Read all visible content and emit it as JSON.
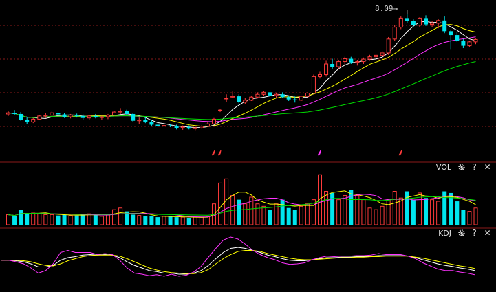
{
  "vol_panel": {
    "label": "VOL",
    "gear_icon": "gear-icon",
    "help_icon": "question-icon",
    "close_icon": "close-icon"
  },
  "kdj_panel": {
    "label": "KDJ",
    "gear_icon": "gear-icon",
    "help_icon": "question-icon",
    "close_icon": "close-icon"
  },
  "peak": {
    "value": "8.09",
    "arrow": "→"
  },
  "colors": {
    "up": "#ff3b3b",
    "down": "#00e5ee",
    "ma5": "#ffffff",
    "ma10": "#ffff00",
    "ma20": "#ff33ff",
    "ma60": "#00dd00",
    "grid": "#8b1a1a"
  },
  "chart_data": [
    {
      "type": "candlestick",
      "price_range": [
        4.4,
        8.3
      ],
      "candles": [
        [
          5.55,
          5.62,
          5.5,
          5.58
        ],
        [
          5.58,
          5.65,
          5.52,
          5.55
        ],
        [
          5.55,
          5.6,
          5.38,
          5.4
        ],
        [
          5.4,
          5.48,
          5.3,
          5.35
        ],
        [
          5.35,
          5.45,
          5.32,
          5.42
        ],
        [
          5.42,
          5.52,
          5.4,
          5.5
        ],
        [
          5.5,
          5.58,
          5.45,
          5.52
        ],
        [
          5.52,
          5.62,
          5.48,
          5.58
        ],
        [
          5.58,
          5.64,
          5.5,
          5.54
        ],
        [
          5.54,
          5.58,
          5.45,
          5.48
        ],
        [
          5.48,
          5.55,
          5.44,
          5.52
        ],
        [
          5.52,
          5.56,
          5.46,
          5.5
        ],
        [
          5.5,
          5.54,
          5.4,
          5.45
        ],
        [
          5.45,
          5.52,
          5.4,
          5.5
        ],
        [
          5.5,
          5.55,
          5.44,
          5.46
        ],
        [
          5.46,
          5.5,
          5.4,
          5.48
        ],
        [
          5.48,
          5.55,
          5.42,
          5.52
        ],
        [
          5.52,
          5.62,
          5.5,
          5.6
        ],
        [
          5.6,
          5.7,
          5.55,
          5.62
        ],
        [
          5.62,
          5.66,
          5.52,
          5.55
        ],
        [
          5.55,
          5.58,
          5.35,
          5.38
        ],
        [
          5.38,
          5.46,
          5.3,
          5.4
        ],
        [
          5.4,
          5.48,
          5.32,
          5.35
        ],
        [
          5.35,
          5.4,
          5.25,
          5.28
        ],
        [
          5.28,
          5.32,
          5.22,
          5.25
        ],
        [
          5.25,
          5.3,
          5.2,
          5.26
        ],
        [
          5.26,
          5.3,
          5.22,
          5.24
        ],
        [
          5.24,
          5.28,
          5.16,
          5.2
        ],
        [
          5.2,
          5.26,
          5.15,
          5.22
        ],
        [
          5.22,
          5.26,
          5.16,
          5.18
        ],
        [
          5.18,
          5.24,
          5.14,
          5.2
        ],
        [
          5.2,
          5.26,
          5.18,
          5.24
        ],
        [
          5.24,
          5.34,
          5.22,
          5.3
        ],
        [
          5.3,
          5.45,
          5.28,
          5.42
        ],
        [
          5.65,
          5.68,
          5.6,
          5.65
        ],
        [
          5.95,
          6.05,
          5.85,
          5.95
        ],
        [
          5.98,
          6.12,
          5.95,
          6.0
        ],
        [
          6.0,
          6.05,
          5.82,
          5.85
        ],
        [
          5.85,
          5.95,
          5.8,
          5.9
        ],
        [
          5.9,
          6.02,
          5.88,
          5.98
        ],
        [
          5.98,
          6.1,
          5.95,
          6.05
        ],
        [
          6.05,
          6.14,
          6.0,
          6.1
        ],
        [
          6.1,
          6.16,
          5.98,
          6.02
        ],
        [
          6.02,
          6.08,
          5.95,
          6.05
        ],
        [
          6.05,
          6.1,
          5.96,
          5.98
        ],
        [
          5.98,
          6.02,
          5.88,
          5.92
        ],
        [
          5.92,
          6.0,
          5.84,
          5.9
        ],
        [
          5.9,
          6.02,
          5.88,
          6.0
        ],
        [
          6.0,
          6.1,
          5.98,
          6.08
        ],
        [
          6.08,
          6.55,
          6.05,
          6.5
        ],
        [
          6.5,
          6.62,
          6.45,
          6.55
        ],
        [
          6.55,
          6.9,
          6.5,
          6.82
        ],
        [
          6.82,
          6.95,
          6.7,
          6.75
        ],
        [
          6.75,
          6.92,
          6.7,
          6.88
        ],
        [
          6.88,
          7.0,
          6.8,
          6.95
        ],
        [
          6.95,
          7.0,
          6.82,
          6.86
        ],
        [
          6.86,
          6.92,
          6.78,
          6.88
        ],
        [
          6.88,
          6.98,
          6.82,
          6.94
        ],
        [
          6.94,
          7.05,
          6.9,
          7.0
        ],
        [
          7.0,
          7.08,
          6.95,
          7.04
        ],
        [
          7.04,
          7.15,
          7.0,
          7.1
        ],
        [
          7.1,
          7.5,
          7.05,
          7.45
        ],
        [
          7.45,
          7.8,
          7.4,
          7.75
        ],
        [
          7.75,
          8.02,
          7.7,
          7.98
        ],
        [
          7.98,
          8.09,
          7.85,
          7.9
        ],
        [
          7.9,
          7.95,
          7.75,
          7.8
        ],
        [
          7.8,
          8.0,
          7.75,
          7.98
        ],
        [
          7.98,
          8.05,
          7.78,
          7.82
        ],
        [
          7.82,
          7.9,
          7.75,
          7.85
        ],
        [
          7.85,
          7.95,
          7.72,
          7.92
        ],
        [
          7.92,
          8.02,
          7.6,
          7.65
        ],
        [
          7.65,
          7.68,
          7.18,
          7.55
        ],
        [
          7.55,
          7.62,
          7.38,
          7.4
        ],
        [
          7.4,
          7.45,
          7.22,
          7.28
        ],
        [
          7.28,
          7.4,
          7.24,
          7.38
        ],
        [
          7.38,
          7.46,
          7.32,
          7.44
        ]
      ],
      "signal_markers": [
        {
          "index": 33,
          "color": "#ff3b3b"
        },
        {
          "index": 34,
          "color": "#ff3b3b"
        },
        {
          "index": 50,
          "color": "#ff33ff"
        },
        {
          "index": 63,
          "color": "#ff3b3b"
        }
      ]
    },
    {
      "type": "bar",
      "name": "VOL",
      "values": [
        12,
        10,
        18,
        14,
        14,
        13,
        12,
        12,
        11,
        12,
        11,
        11,
        12,
        13,
        12,
        10,
        12,
        18,
        20,
        16,
        12,
        11,
        10,
        10,
        9,
        10,
        10,
        9,
        9,
        8,
        9,
        9,
        10,
        25,
        50,
        55,
        35,
        30,
        25,
        33,
        25,
        22,
        18,
        25,
        30,
        20,
        18,
        22,
        25,
        30,
        60,
        40,
        38,
        30,
        35,
        42,
        35,
        30,
        20,
        18,
        22,
        30,
        40,
        32,
        40,
        30,
        38,
        32,
        30,
        28,
        40,
        38,
        28,
        18,
        16,
        20
      ]
    },
    {
      "type": "line",
      "name": "KDJ",
      "y_range": [
        0,
        100
      ],
      "series": [
        {
          "name": "K",
          "color": "#ffffff",
          "values": [
            55,
            55,
            54,
            52,
            48,
            42,
            42,
            45,
            55,
            60,
            62,
            65,
            66,
            65,
            66,
            65,
            60,
            52,
            45,
            40,
            35,
            33,
            30,
            30,
            28,
            28,
            30,
            35,
            45,
            58,
            70,
            78,
            80,
            78,
            74,
            70,
            65,
            62,
            58,
            55,
            54,
            54,
            56,
            58,
            60,
            60,
            61,
            61,
            62,
            62,
            63,
            64,
            64,
            64,
            64,
            63,
            60,
            56,
            52,
            48,
            45,
            43,
            40,
            38,
            35
          ]
        },
        {
          "name": "D",
          "color": "#ffff00",
          "values": [
            55,
            55,
            55,
            54,
            52,
            48,
            45,
            44,
            48,
            54,
            58,
            62,
            64,
            65,
            65,
            65,
            63,
            58,
            52,
            46,
            40,
            36,
            33,
            31,
            30,
            29,
            29,
            31,
            37,
            48,
            58,
            66,
            72,
            74,
            74,
            72,
            68,
            65,
            62,
            59,
            57,
            56,
            56,
            57,
            58,
            59,
            60,
            60,
            61,
            61,
            62,
            62,
            63,
            63,
            63,
            63,
            61,
            59,
            56,
            53,
            50,
            47,
            44,
            42,
            39
          ]
        },
        {
          "name": "J",
          "color": "#ff33ff",
          "values": [
            55,
            55,
            52,
            48,
            40,
            30,
            35,
            48,
            70,
            74,
            70,
            70,
            70,
            66,
            68,
            66,
            55,
            40,
            30,
            28,
            25,
            27,
            24,
            28,
            24,
            26,
            32,
            43,
            61,
            78,
            94,
            100,
            96,
            86,
            74,
            66,
            60,
            56,
            50,
            47,
            48,
            50,
            56,
            60,
            63,
            62,
            63,
            63,
            64,
            64,
            65,
            68,
            66,
            66,
            66,
            63,
            58,
            50,
            44,
            38,
            35,
            35,
            32,
            30,
            27
          ]
        }
      ]
    }
  ]
}
